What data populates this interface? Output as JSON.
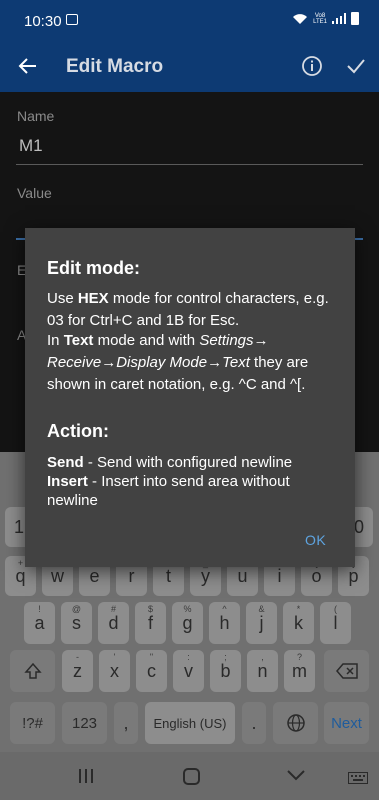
{
  "status_bar": {
    "time": "10:30",
    "lte_top": "Vo8",
    "lte_bottom": "LTE1"
  },
  "app_bar": {
    "title": "Edit Macro"
  },
  "form": {
    "name_label": "Name",
    "name_value": "M1",
    "value_label": "Value",
    "edit_label_frag": "Ed",
    "action_label_frag": "A"
  },
  "dialog": {
    "edit_title": "Edit mode:",
    "edit_p1_a": "Use ",
    "edit_p1_hex": "HEX",
    "edit_p1_b": " mode for control characters, e.g. 03 for Ctrl+C and 1B for Esc.",
    "edit_p2_a": "In ",
    "edit_p2_text": "Text",
    "edit_p2_b": " mode and with ",
    "edit_p2_path": "Settings→ Receive→Display Mode→Text",
    "edit_p2_c": " they are shown in caret notation, e.g. ^C and ^[.",
    "action_title": "Action:",
    "send_label": "Send",
    "send_desc": " - Send with configured newline",
    "insert_label": "Insert",
    "insert_desc": " - Insert into send area without newline",
    "ok": "OK"
  },
  "keyboard": {
    "row0": [
      "1",
      "0"
    ],
    "row1": [
      "q",
      "w",
      "e",
      "r",
      "t",
      "y",
      "u",
      "i",
      "o",
      "p"
    ],
    "row1_hints": [
      "+",
      "×",
      "÷",
      "=",
      "/",
      "_",
      "<",
      ">",
      "[",
      "]"
    ],
    "row2": [
      "a",
      "s",
      "d",
      "f",
      "g",
      "h",
      "j",
      "k",
      "l"
    ],
    "row2_hints": [
      "!",
      "@",
      "#",
      "$",
      "%",
      "^",
      "&",
      "*",
      "("
    ],
    "row3": [
      "z",
      "x",
      "c",
      "v",
      "b",
      "n",
      "m"
    ],
    "row3_hints": [
      "-",
      "'",
      "\"",
      ":",
      ";",
      ",",
      "?"
    ],
    "symbols": "!?#",
    "numbers": "123",
    "comma": ",",
    "space": "English (US)",
    "period": ".",
    "next": "Next"
  },
  "colors": {
    "app_bar": "#0d3a73",
    "dialog_bg": "#424242",
    "accent": "#5ea4e0"
  }
}
